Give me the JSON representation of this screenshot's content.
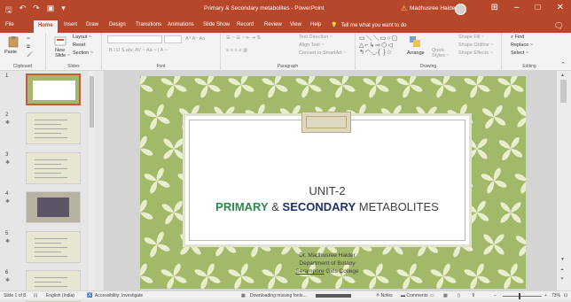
{
  "title_bar": {
    "doc_title": "Primary & Secondary metabolites - PowerPoint",
    "user_name": "Madhusree Halder",
    "warning_icon": "warning-icon",
    "qat_icons": [
      "save-icon",
      "undo-icon",
      "redo-icon",
      "present-icon",
      "customize-icon"
    ],
    "window_controls": [
      "ribbon-display-icon",
      "minimize-icon",
      "maximize-icon",
      "close-icon"
    ]
  },
  "tabs": [
    "File",
    "Home",
    "Insert",
    "Draw",
    "Design",
    "Transitions",
    "Animations",
    "Slide Show",
    "Record",
    "Review",
    "View",
    "Help"
  ],
  "active_tab": "Home",
  "tell_me": "Tell me what you want to do",
  "ribbon": {
    "clipboard": {
      "label": "Clipboard",
      "paste": "Paste"
    },
    "slides": {
      "label": "Slides",
      "new_slide": "New\nSlide",
      "layout": "Layout ~",
      "reset": "Reset",
      "section": "Section ~"
    },
    "font": {
      "label": "Font",
      "format_row": "B  I  U  S  abc  AV ~  Aa ~  |  A ~",
      "size_row": "A⁺  A⁻  Ao"
    },
    "paragraph": {
      "label": "Paragraph",
      "text_direction": "Text Direction ~",
      "align_text": "Align Text ~",
      "smartart": "Convert to SmartArt ~"
    },
    "drawing": {
      "label": "Drawing",
      "arrange": "Arrange",
      "quick_styles": "Quick\nStyles ~",
      "shape_fill": "Shape Fill ~",
      "shape_outline": "Shape Outline ~",
      "shape_effects": "Shape Effects ~"
    },
    "editing": {
      "label": "Editing",
      "find": "Find",
      "replace": "Replace ~",
      "select": "Select ~"
    }
  },
  "slides_panel": {
    "thumbnails": [
      {
        "num": "1",
        "selected": true
      },
      {
        "num": "2",
        "selected": false
      },
      {
        "num": "3",
        "selected": false
      },
      {
        "num": "4",
        "selected": false
      },
      {
        "num": "5",
        "selected": false
      },
      {
        "num": "6",
        "selected": false
      }
    ]
  },
  "slide": {
    "unit": "UNIT-2",
    "heading_primary": "PRIMARY",
    "heading_amp": " & ",
    "heading_secondary": "SECONDARY",
    "heading_rest": " METABOLITES",
    "author_name": "Dr. Madhusree Halder",
    "author_dept": "Department of Botany",
    "author_college_under": "Serampore",
    "author_college_rest": " Girls College",
    "background_color": "#a3b96a",
    "pattern_color": "#e9eecf"
  },
  "status_bar": {
    "slide_info": "Slide 1 of 8",
    "language": "English (India)",
    "accessibility": "Accessibility: Investigate",
    "download": "Downloading missing fonts...",
    "download_progress": 1.0,
    "notes": "Notes",
    "comments": "Comments",
    "zoom": "73%",
    "zoom_fraction": 0.4
  }
}
